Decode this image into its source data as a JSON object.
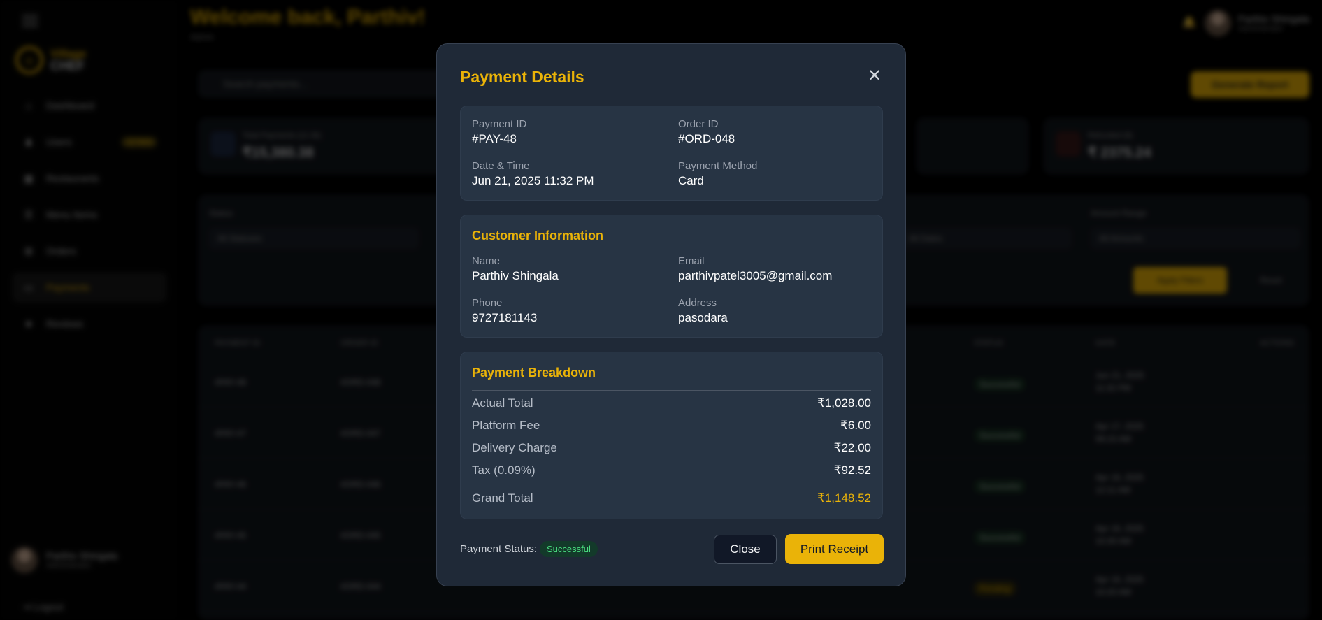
{
  "app": {
    "welcome": "Welcome back, Parthiv!",
    "welcome_sub": "Admin",
    "logo_line1": "Village",
    "logo_line2": "CHEF",
    "nav": [
      {
        "label": "Dashboard",
        "icon": "home-icon"
      },
      {
        "label": "Users",
        "icon": "users-icon",
        "badge": "12 New"
      },
      {
        "label": "Restaurants",
        "icon": "store-icon"
      },
      {
        "label": "Menu Items",
        "icon": "menu-icon"
      },
      {
        "label": "Orders",
        "icon": "cart-icon"
      },
      {
        "label": "Payments",
        "icon": "card-icon"
      },
      {
        "label": "Reviews",
        "icon": "star-icon"
      }
    ],
    "user_name": "Parthiv Shingala",
    "user_role": "Administrator",
    "logout": "Logout",
    "search_placeholder": "Search payments...",
    "generate_report": "Generate Report",
    "cards": [
      {
        "label": "Total Payments (12.3k)",
        "value": "₹15,380.38"
      },
      {
        "label": "Refunded (8)",
        "value": "₹ 2375.24"
      }
    ],
    "filters": {
      "status_label": "Status",
      "status_value": "All Statuses",
      "amount_label": "Amount Range",
      "amount_value": "All Amounts",
      "date_value": "All Dates",
      "apply": "Apply Filters",
      "reset": "Reset"
    },
    "table_headers": [
      "PAYMENT ID",
      "ORDER ID",
      "STATUS",
      "DATE",
      "ACTIONS"
    ],
    "rows": [
      {
        "pid": "#PAY-48",
        "oid": "#ORD-048",
        "status": "Successful",
        "date": "Jun 21, 2025",
        "time": "11:32 PM"
      },
      {
        "pid": "#PAY-47",
        "oid": "#ORD-047",
        "status": "Successful",
        "date": "Apr 17, 2025",
        "time": "09:15 AM"
      },
      {
        "pid": "#PAY-46",
        "oid": "#ORD-046",
        "status": "Successful",
        "date": "Apr 16, 2025",
        "time": "12:11 AM"
      },
      {
        "pid": "#PAY-45",
        "oid": "#ORD-045",
        "status": "Successful",
        "date": "Apr 16, 2025",
        "time": "10:30 AM"
      },
      {
        "pid": "#PAY-44",
        "oid": "#ORD-044",
        "status": "Pending",
        "date": "Apr 16, 2025",
        "time": "10:20 AM"
      }
    ]
  },
  "modal": {
    "title": "Payment Details",
    "details": {
      "payment_id_label": "Payment ID",
      "payment_id": "#PAY-48",
      "order_id_label": "Order ID",
      "order_id": "#ORD-048",
      "datetime_label": "Date & Time",
      "datetime": "Jun 21, 2025 11:32 PM",
      "method_label": "Payment Method",
      "method": "Card"
    },
    "customer": {
      "title": "Customer Information",
      "name_label": "Name",
      "name": "Parthiv Shingala",
      "email_label": "Email",
      "email": "parthivpatel3005@gmail.com",
      "phone_label": "Phone",
      "phone": "9727181143",
      "address_label": "Address",
      "address": "pasodara"
    },
    "breakdown": {
      "title": "Payment Breakdown",
      "rows": [
        {
          "label": "Actual Total",
          "amount": "₹1,028.00"
        },
        {
          "label": "Platform Fee",
          "amount": "₹6.00"
        },
        {
          "label": "Delivery Charge",
          "amount": "₹22.00"
        },
        {
          "label": "Tax (0.09%)",
          "amount": "₹92.52"
        }
      ],
      "grand_label": "Grand Total",
      "grand_amount": "₹1,148.52"
    },
    "status_label": "Payment Status:",
    "status_value": "Successful",
    "close_label": "Close",
    "print_label": "Print Receipt"
  },
  "colors": {
    "accent": "#eab308",
    "success": "#4ade80",
    "panel": "#1f2937"
  }
}
